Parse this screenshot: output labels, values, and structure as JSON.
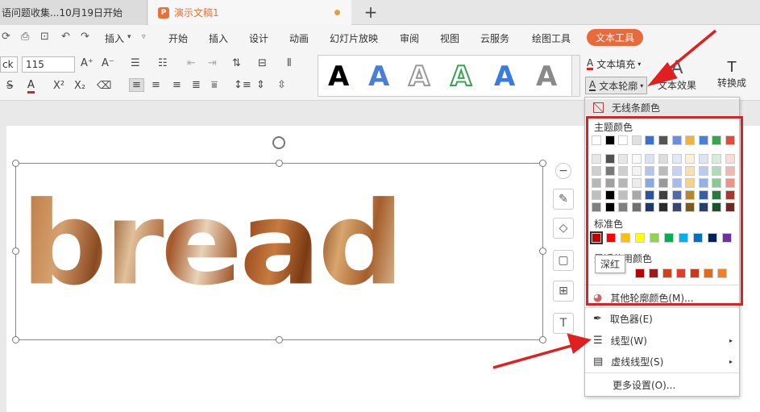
{
  "tabs": {
    "tab1": "语问题收集...10月19日开始",
    "tab2": "演示文稿1",
    "new": "+"
  },
  "menu": {
    "insert_quick": "插入",
    "items": [
      "开始",
      "插入",
      "设计",
      "动画",
      "幻灯片放映",
      "审阅",
      "视图",
      "云服务",
      "绘图工具",
      "文本工具"
    ],
    "active": "文本工具"
  },
  "toolbar": {
    "font": "ck",
    "size": "115",
    "text_fill": "文本填充",
    "text_outline": "文本轮廓",
    "text_effect": "文本效果",
    "wrap": "转换成"
  },
  "slide": {
    "word": "bread"
  },
  "dropdown": {
    "no_line": "无线条颜色",
    "theme_colors": "主题颜色",
    "standard_colors": "标准色",
    "recent_colors": "最近使用颜色",
    "more_colors": "其他轮廓颜色(M)...",
    "eyedropper": "取色器(E)",
    "line_type": "线型(W)",
    "dash_type": "虚线线型(S)",
    "more_settings": "更多设置(O)...",
    "tooltip": "深红"
  },
  "colors": {
    "theme_row": [
      "#ffffff",
      "#000000",
      "#ffffff",
      "#e0e0e0",
      "#3b6fd1",
      "#555555",
      "#6b8fe0",
      "#f0b23c",
      "#4a7fd6",
      "#39a34f",
      "#e04b3b"
    ],
    "standard": [
      "#c00000",
      "#ff0000",
      "#ffc000",
      "#ffff00",
      "#92d050",
      "#00b050",
      "#00b0f0",
      "#0070c0",
      "#002060",
      "#7030a0"
    ],
    "recent": [
      "#c00000",
      "#9b1c1c",
      "#d0421b",
      "#e03b2b",
      "#c83a1b",
      "#e06a1f",
      "#f0802a"
    ],
    "accent": "#e86a3c",
    "frame": "#e02020"
  }
}
